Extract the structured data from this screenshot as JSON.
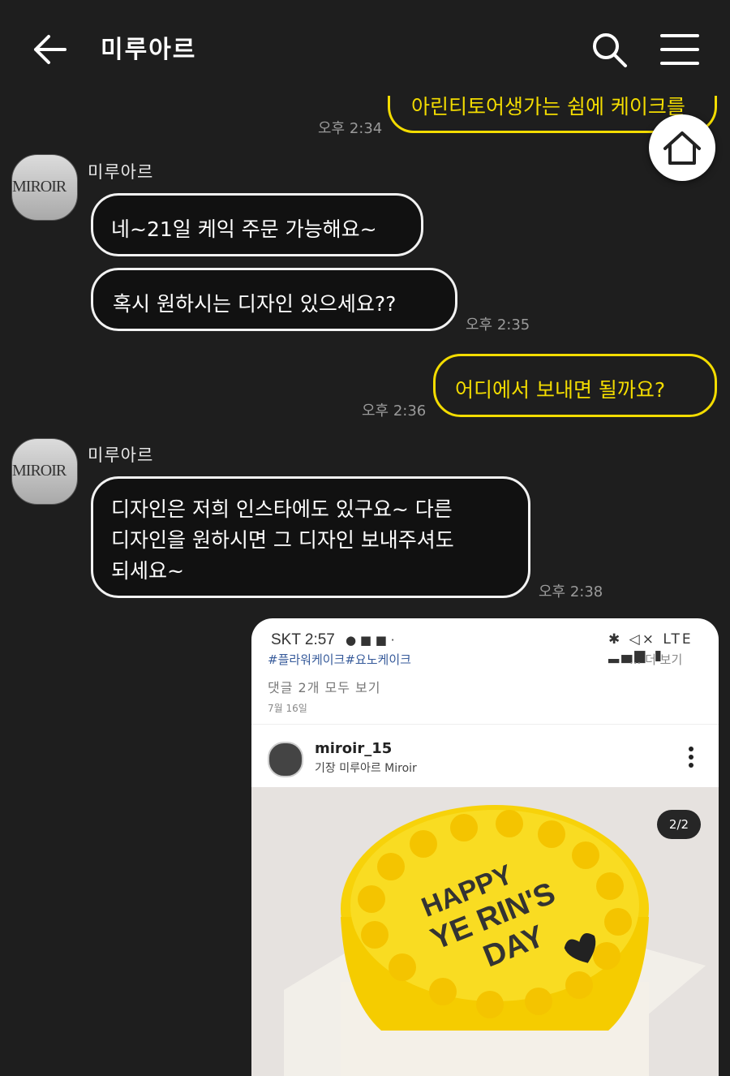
{
  "header": {
    "title": "미루아르"
  },
  "colors": {
    "accent": "#f3dc00",
    "background": "#1e1e1e"
  },
  "icons": {
    "back": "arrow-left-icon",
    "search": "search-icon",
    "menu": "hamburger-menu-icon",
    "home": "home-icon"
  },
  "messages": [
    {
      "from": "me",
      "text": "아린티토어생가는 쉼에 케이크를",
      "time": "오후 2:34"
    },
    {
      "from": "other",
      "sender": "미루아르",
      "avatar_text": "MIROIR",
      "text": "네~21일 케익 주문 가능해요~"
    },
    {
      "from": "other",
      "text": "혹시 원하시는 디자인 있으세요??",
      "time": "오후 2:35"
    },
    {
      "from": "me",
      "text": "어디에서 보내면 될까요?",
      "time": "오후 2:36"
    },
    {
      "from": "other",
      "sender": "미루아르",
      "avatar_text": "MIROIR",
      "lines": [
        "디자인은 저희 인스타에도 있구요~ 다른",
        "디자인을 원하시면 그 디자인 보내주셔도",
        "되세요~"
      ],
      "time": "오후 2:38"
    }
  ],
  "screenshot": {
    "carrier": "SKT 2:57",
    "status_icons": "✱ ◁× LTE ▂▄▆ ▮",
    "hashtags": "#플라워케이크#요노케이크",
    "more": "... 더 보기",
    "comments": "댓글 2개 모두 보기",
    "date": "7월 16일",
    "username": "miroir_15",
    "location": "기장 미루아르 Miroir",
    "page_indicator": "2/2",
    "cake_text": [
      "HAPPY",
      "YE RIN'S",
      "DAY"
    ],
    "cake_color": "#f7d20a"
  }
}
